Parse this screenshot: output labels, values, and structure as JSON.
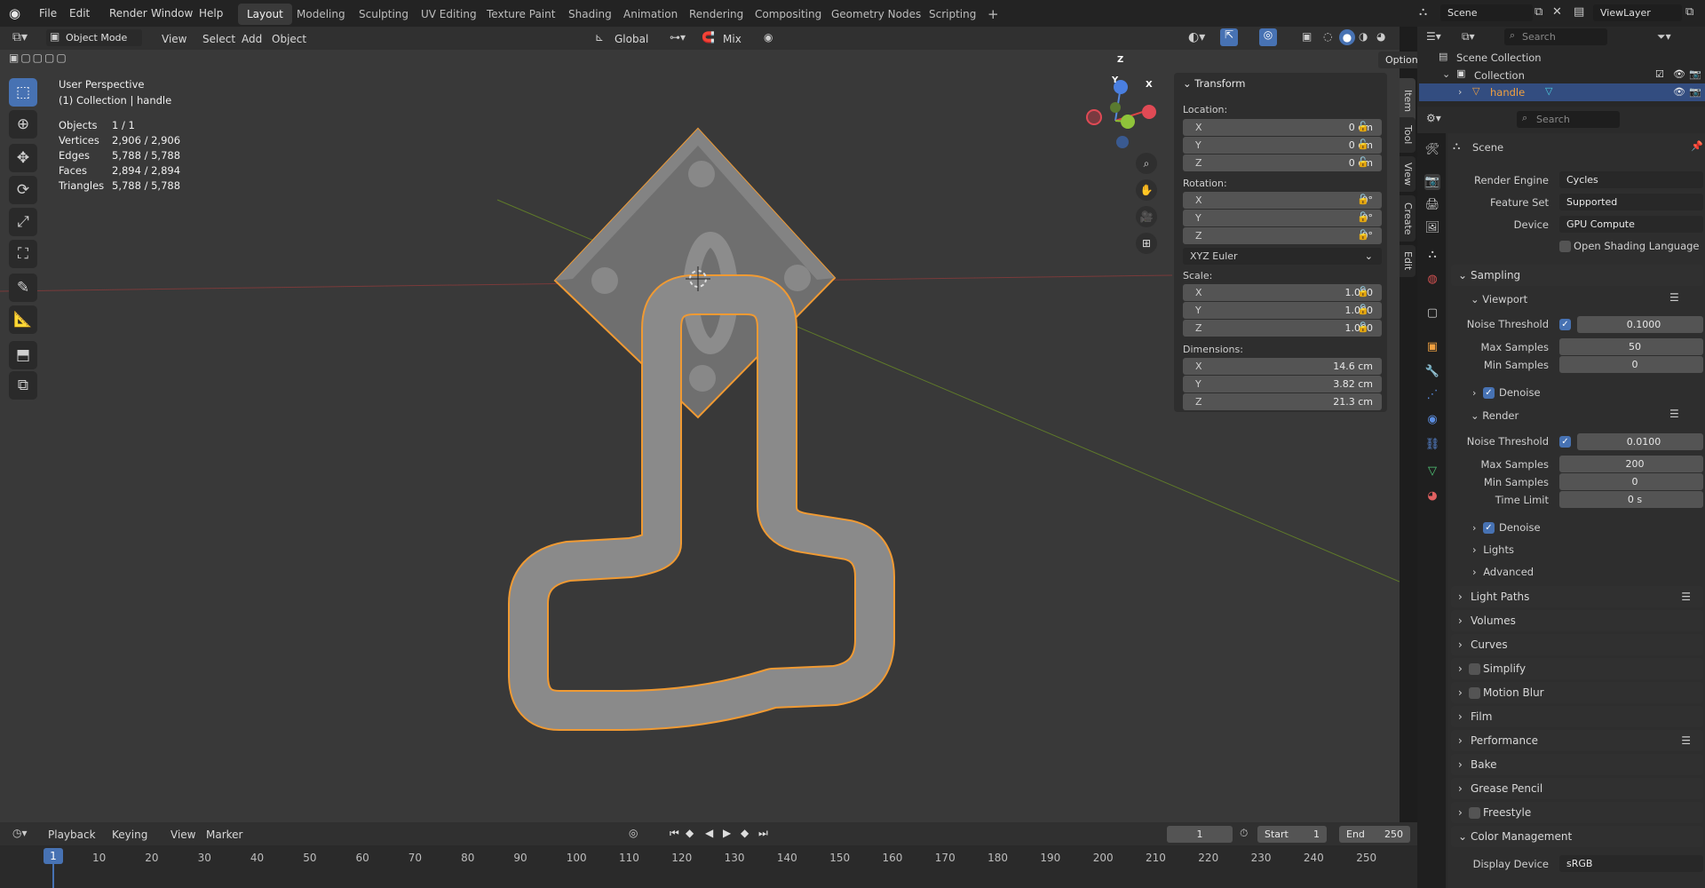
{
  "topbar": {
    "menus": [
      "File",
      "Edit",
      "Render",
      "Window",
      "Help"
    ],
    "workspaces": [
      "Layout",
      "Modeling",
      "Sculpting",
      "UV Editing",
      "Texture Paint",
      "Shading",
      "Animation",
      "Rendering",
      "Compositing",
      "Geometry Nodes",
      "Scripting"
    ],
    "add": "+",
    "scene": "Scene",
    "viewlayer": "ViewLayer"
  },
  "viewport": {
    "mode": "Object Mode",
    "menus": [
      "View",
      "Select",
      "Add",
      "Object"
    ],
    "orientation": "Global",
    "snap": "Mix",
    "options": "Options",
    "perspective": "User Perspective",
    "context": "(1) Collection | handle",
    "stats": [
      {
        "k": "Objects",
        "v": "1 / 1"
      },
      {
        "k": "Vertices",
        "v": "2,906 / 2,906"
      },
      {
        "k": "Edges",
        "v": "5,788 / 5,788"
      },
      {
        "k": "Faces",
        "v": "2,894 / 2,894"
      },
      {
        "k": "Triangles",
        "v": "5,788 / 5,788"
      }
    ],
    "gizmo": {
      "z": "Z",
      "y": "Y",
      "x": "X"
    }
  },
  "transform": {
    "title": "Transform",
    "location_label": "Location:",
    "rotation_label": "Rotation:",
    "scale_label": "Scale:",
    "dimensions_label": "Dimensions:",
    "location": [
      {
        "a": "X",
        "v": "0 cm"
      },
      {
        "a": "Y",
        "v": "0 cm"
      },
      {
        "a": "Z",
        "v": "0 cm"
      }
    ],
    "rotation": [
      {
        "a": "X",
        "v": "0°"
      },
      {
        "a": "Y",
        "v": "0°"
      },
      {
        "a": "Z",
        "v": "0°"
      }
    ],
    "rotation_mode": "XYZ Euler",
    "scale": [
      {
        "a": "X",
        "v": "1.000"
      },
      {
        "a": "Y",
        "v": "1.000"
      },
      {
        "a": "Z",
        "v": "1.000"
      }
    ],
    "dimensions": [
      {
        "a": "X",
        "v": "14.6 cm"
      },
      {
        "a": "Y",
        "v": "3.82 cm"
      },
      {
        "a": "Z",
        "v": "21.3 cm"
      }
    ]
  },
  "sidetabs": [
    "Item",
    "Tool",
    "View",
    "Create",
    "Edit"
  ],
  "outliner": {
    "search": "Search",
    "scene_collection": "Scene Collection",
    "collection": "Collection",
    "object": "handle"
  },
  "properties": {
    "search": "Search",
    "scene": "Scene",
    "render_engine_label": "Render Engine",
    "render_engine": "Cycles",
    "feature_set_label": "Feature Set",
    "feature_set": "Supported",
    "device_label": "Device",
    "device": "GPU Compute",
    "osl": "Open Shading Language",
    "sampling": "Sampling",
    "viewport": "Viewport",
    "noise_threshold_label": "Noise Threshold",
    "vp_noise": "0.1000",
    "max_samples_label": "Max Samples",
    "vp_max": "50",
    "min_samples_label": "Min Samples",
    "vp_min": "0",
    "denoise": "Denoise",
    "render": "Render",
    "r_noise": "0.0100",
    "r_max": "200",
    "r_min": "0",
    "time_limit_label": "Time Limit",
    "time_limit": "0 s",
    "lights": "Lights",
    "advanced": "Advanced",
    "sections": [
      "Light Paths",
      "Volumes",
      "Curves",
      "Simplify",
      "Motion Blur",
      "Film",
      "Performance",
      "Bake",
      "Grease Pencil",
      "Freestyle",
      "Color Management"
    ],
    "display_device_label": "Display Device",
    "display_device": "sRGB"
  },
  "timeline": {
    "menus": [
      "Playback",
      "Keying",
      "View",
      "Marker"
    ],
    "current": "1",
    "start_label": "Start",
    "start": "1",
    "end_label": "End",
    "end": "250",
    "ticks": [
      "10",
      "20",
      "30",
      "40",
      "50",
      "60",
      "70",
      "80",
      "90",
      "100",
      "110",
      "120",
      "130",
      "140",
      "150",
      "160",
      "170",
      "180",
      "190",
      "200",
      "210",
      "220",
      "230",
      "240",
      "250"
    ],
    "playhead": "1"
  }
}
